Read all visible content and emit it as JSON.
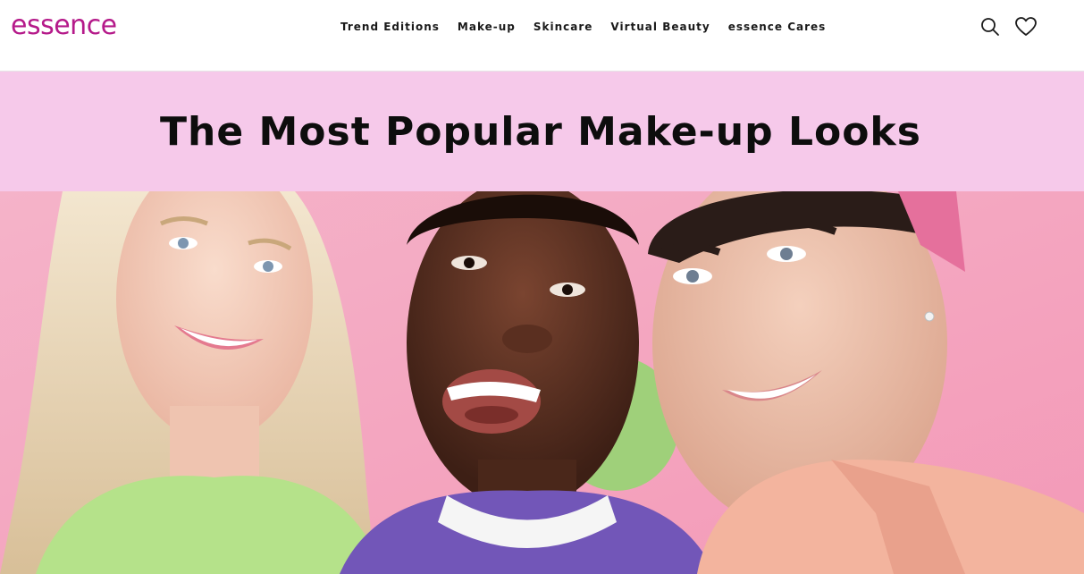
{
  "header": {
    "logo_text": "essence",
    "nav": [
      {
        "label": "Trend Editions"
      },
      {
        "label": "Make-up"
      },
      {
        "label": "Skincare"
      },
      {
        "label": "Virtual Beauty"
      },
      {
        "label": "essence Cares"
      }
    ],
    "icons": [
      "search-icon",
      "heart-icon"
    ]
  },
  "hero_title": "The Most Popular Make-up Looks",
  "colors": {
    "brand": "#b51a8a",
    "title_band": "#f6c9ea",
    "hero_background": "#f6a8c4"
  }
}
